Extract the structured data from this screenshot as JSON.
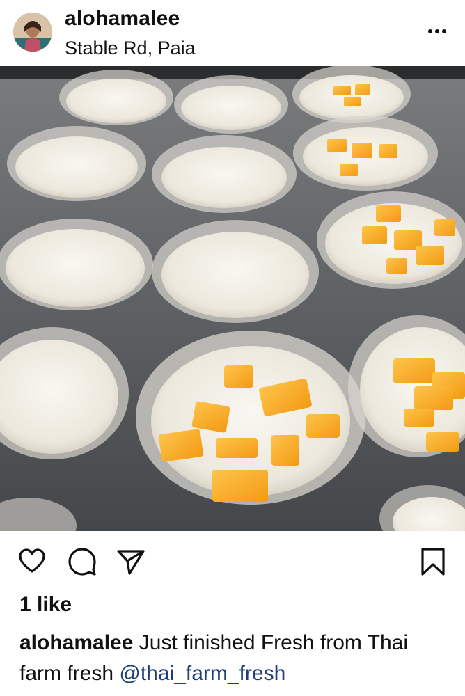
{
  "post": {
    "username": "alohamalee",
    "location": "Stable Rd, Paia",
    "likes_text": "1 like",
    "caption_user": "alohamalee",
    "caption_text": "Just finished Fresh from Thai farm fresh",
    "caption_mention": "@thai_farm_fresh"
  },
  "icons": {
    "more": "more-horizontal-icon",
    "like": "heart-icon",
    "comment": "comment-icon",
    "share": "send-icon",
    "save": "bookmark-icon"
  },
  "colors": {
    "mention": "#1f3f7a",
    "text": "#111111"
  }
}
